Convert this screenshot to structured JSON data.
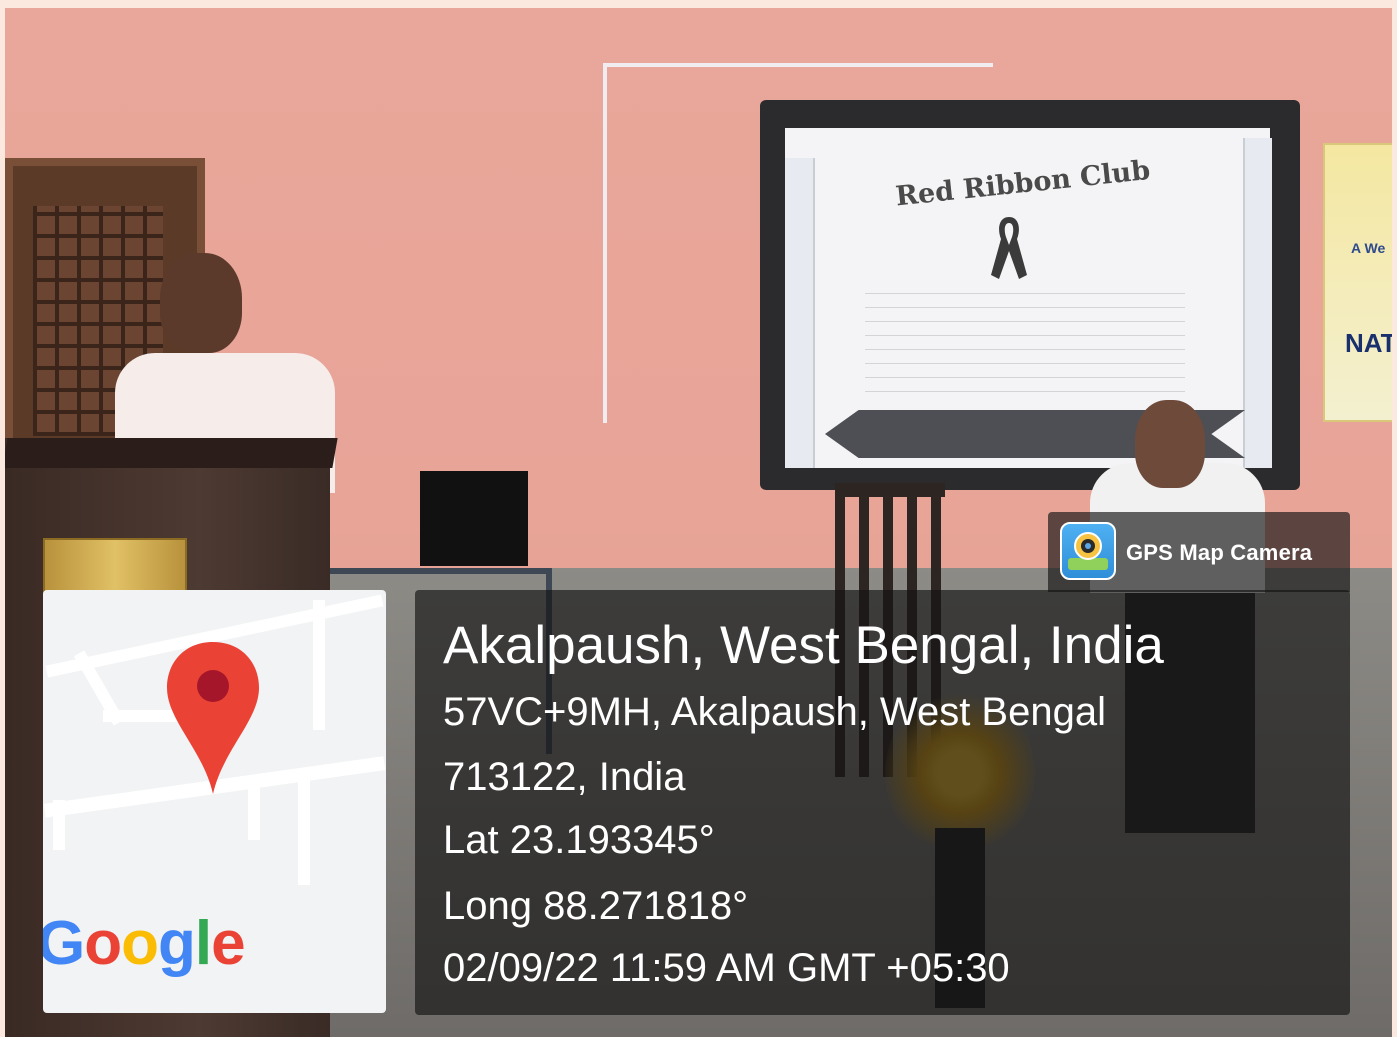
{
  "colors": {
    "page_border": "#fbe9df",
    "wall": "#e9a69a",
    "overlay": "rgba(20,20,20,0.66)",
    "pin_red": "#ea4335",
    "google_blue": "#4285f4",
    "google_red": "#ea4335",
    "google_yellow": "#fbbc05",
    "google_green": "#34a853"
  },
  "scene": {
    "slide_title": "Red Ribbon Club",
    "banner_text_1": "A We",
    "banner_text_2": "NAT"
  },
  "gps": {
    "brand": "GPS Map Camera",
    "title": "Akalpaush, West Bengal, India",
    "address_line1": "57VC+9MH, Akalpaush, West Bengal",
    "address_line2": "713122, India",
    "lat": "Lat 23.193345°",
    "long": "Long 88.271818°",
    "datetime": "02/09/22 11:59 AM GMT +05:30"
  },
  "map": {
    "logo_letters": [
      "G",
      "o",
      "o",
      "g",
      "l",
      "e"
    ]
  },
  "icons": [
    "gps-map-camera-icon",
    "map-pin-icon",
    "ribbon-icon"
  ]
}
